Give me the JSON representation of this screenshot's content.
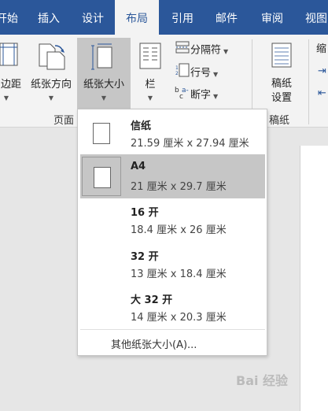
{
  "tabs": [
    {
      "label": "开始",
      "display": "开始"
    },
    {
      "label": "插入"
    },
    {
      "label": "设计"
    },
    {
      "label": "布局"
    },
    {
      "label": "引用"
    },
    {
      "label": "邮件"
    },
    {
      "label": "审阅"
    },
    {
      "label": "视图"
    }
  ],
  "ribbon": {
    "margins_label": "边距",
    "orientation_label": "纸张方向",
    "size_label": "纸张大小",
    "columns_label": "栏",
    "breaks_label": "分隔符",
    "line_numbers_label": "行号",
    "hyphenation_label": "断字",
    "draft_settings_label": "稿纸\n设置",
    "draft_settings_line1": "稿纸",
    "draft_settings_line2": "设置",
    "group_page_label": "页面",
    "group_draft_label": "稿纸",
    "partial_next_label": "缩"
  },
  "dropdown": {
    "items": [
      {
        "name": "信纸",
        "size": "21.59 厘米 x 27.94 厘米",
        "selected": false
      },
      {
        "name": "A4",
        "size": "21 厘米 x 29.7 厘米",
        "selected": true
      },
      {
        "name": "16 开",
        "size": "18.4 厘米 x 26 厘米",
        "selected": false
      },
      {
        "name": "32 开",
        "size": "13 厘米 x 18.4 厘米",
        "selected": false
      },
      {
        "name": "大 32 开",
        "size": "14 厘米 x 20.3 厘米",
        "selected": false
      }
    ],
    "more_label": "其他纸张大小(A)..."
  },
  "watermark": "Bai 经验",
  "colors": {
    "tab_bar": "#2b579a",
    "ribbon_bg": "#f3f3f3",
    "selected_bg": "#c6c6c6",
    "doc_bg": "#e6e6e6"
  }
}
